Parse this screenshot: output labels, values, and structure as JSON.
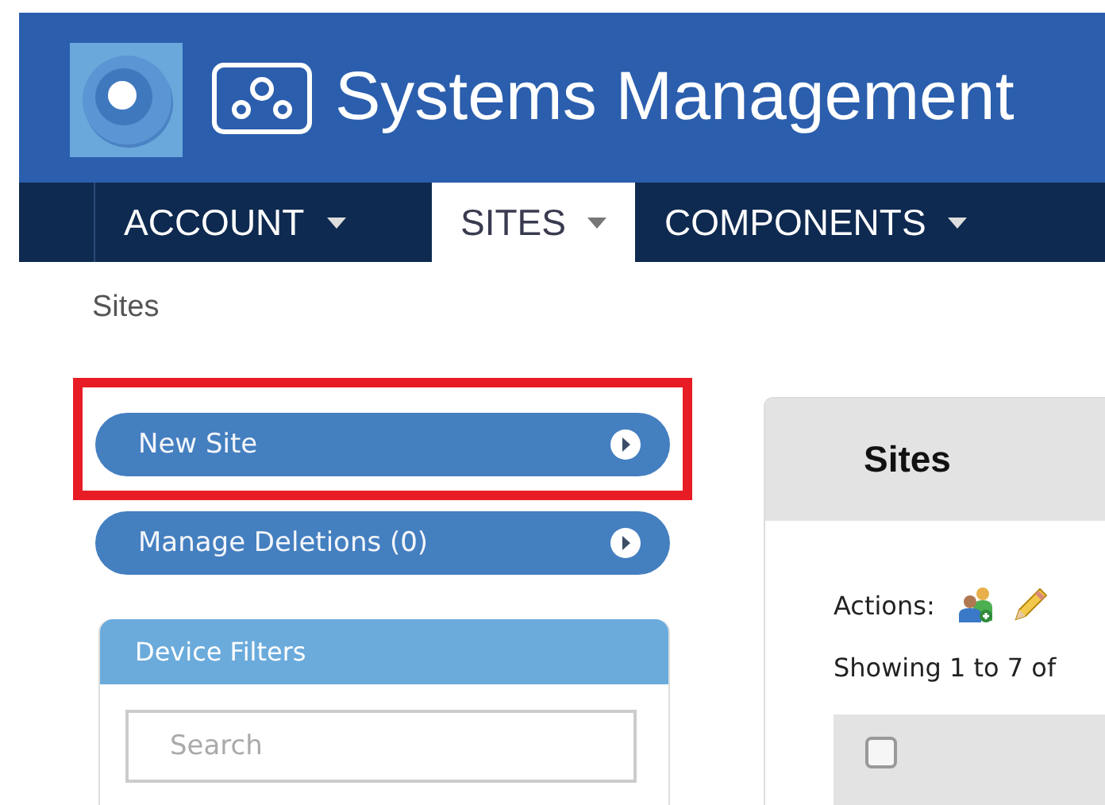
{
  "header": {
    "title": "Systems Management"
  },
  "nav": [
    {
      "label": "ACCOUNT",
      "selected": false
    },
    {
      "label": "SITES",
      "selected": true
    },
    {
      "label": "COMPONENTS",
      "selected": false
    }
  ],
  "breadcrumb": "Sites",
  "actions": [
    {
      "label": "New Site",
      "highlighted": true
    },
    {
      "label": "Manage Deletions (0)",
      "highlighted": false
    }
  ],
  "device_filters": {
    "title": "Device Filters",
    "search": {
      "placeholder": "Search"
    }
  },
  "sites_panel": {
    "title": "Sites",
    "actions_label": "Actions:",
    "showing": "Showing 1 to 7 of",
    "select_all": {
      "checked": false
    }
  }
}
